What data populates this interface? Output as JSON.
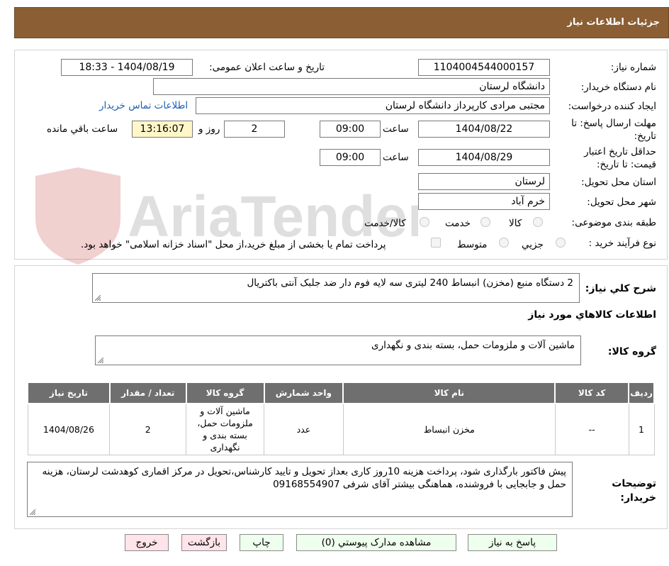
{
  "header": {
    "title": "جزئیات اطلاعات نیاز"
  },
  "fields": {
    "need_number_label": "شماره نیاز:",
    "need_number": "1104004544000157",
    "announce_label": "تاریخ و ساعت اعلان عمومی:",
    "announce_value": "1404/08/19 - 18:33",
    "buyer_org_label": "نام دستگاه خریدار:",
    "buyer_org": "دانشگاه لرستان",
    "requester_label": "ایجاد کننده درخواست:",
    "requester": "مجتبی مرادی کارپرداز دانشگاه لرستان",
    "buyer_contact_link": "اطلاعات تماس خریدار",
    "deadline_label": "مهلت ارسال پاسخ: تا تاریخ:",
    "deadline_date": "1404/08/22",
    "time_label": "ساعت",
    "deadline_time": "09:00",
    "remaining_days": "2",
    "days_label": "روز و",
    "remaining_time": "13:16:07",
    "remaining_label": "ساعت باقي مانده",
    "validity_label": "حداقل تاریخ اعتبار قیمت: تا تاریخ:",
    "validity_date": "1404/08/29",
    "validity_time": "09:00",
    "province_label": "استان محل تحویل:",
    "province": "لرستان",
    "city_label": "شهر محل تحویل:",
    "city": "خرم آباد",
    "category_label": "طبقه بندی موضوعی:",
    "category_options": [
      "کالا",
      "خدمت",
      "کالا/خدمت"
    ],
    "process_label": "نوع فرآیند خرید :",
    "process_options": [
      "جزيي",
      "متوسط"
    ],
    "payment_note": "پرداخت تمام یا بخشی از مبلغ خرید،از محل \"اسناد خزانه اسلامی\" خواهد بود."
  },
  "summary": {
    "label": "شرح کلي نیاز:",
    "value": "2 دستگاه منبع (مخزن) انبساط 240 لیتری سه لایه فوم دار ضد جلبک آنتی باکتریال",
    "items_heading": "اطلاعات کالاهاي مورد نیاز",
    "group_label": "گروه کالا:",
    "group_value": "ماشین آلات و ملزومات حمل، بسته بندی و نگهداری"
  },
  "table": {
    "headers": [
      "ردیف",
      "کد کالا",
      "نام کالا",
      "واحد شمارش",
      "گروه کالا",
      "تعداد / مقدار",
      "تاریخ نیاز"
    ],
    "rows": [
      {
        "row": "1",
        "code": "--",
        "name": "مخزن انبساط",
        "unit": "عدد",
        "group": "ماشین آلات و ملزومات حمل، بسته بندی و نگهداری",
        "qty": "2",
        "date": "1404/08/26"
      }
    ]
  },
  "notes": {
    "label": "توضیحات خریدار:",
    "value": "پیش فاکتور بارگذاری شود، پرداخت هزینه 10روز کاری بعداز تحویل و تایید کارشناس،تحویل در مرکز اقماری کوهدشت لرستان، هزینه  حمل و جابجایی با فروشنده، هماهنگی بیشتر آقای شرفی 09168554907"
  },
  "buttons": {
    "reply": "پاسخ به نیاز",
    "attachments": "مشاهده مدارک پیوستي (0)",
    "print": "چاپ",
    "back": "بازگشت",
    "exit": "خروج"
  },
  "watermark": {
    "text": "AriaTender.neT"
  },
  "colors": {
    "header_bg": "#8b5e34",
    "table_header_bg": "#6f6f6f",
    "button_green": "#efffee",
    "button_pink": "#ffe4ea",
    "link": "#1a5fb4"
  }
}
